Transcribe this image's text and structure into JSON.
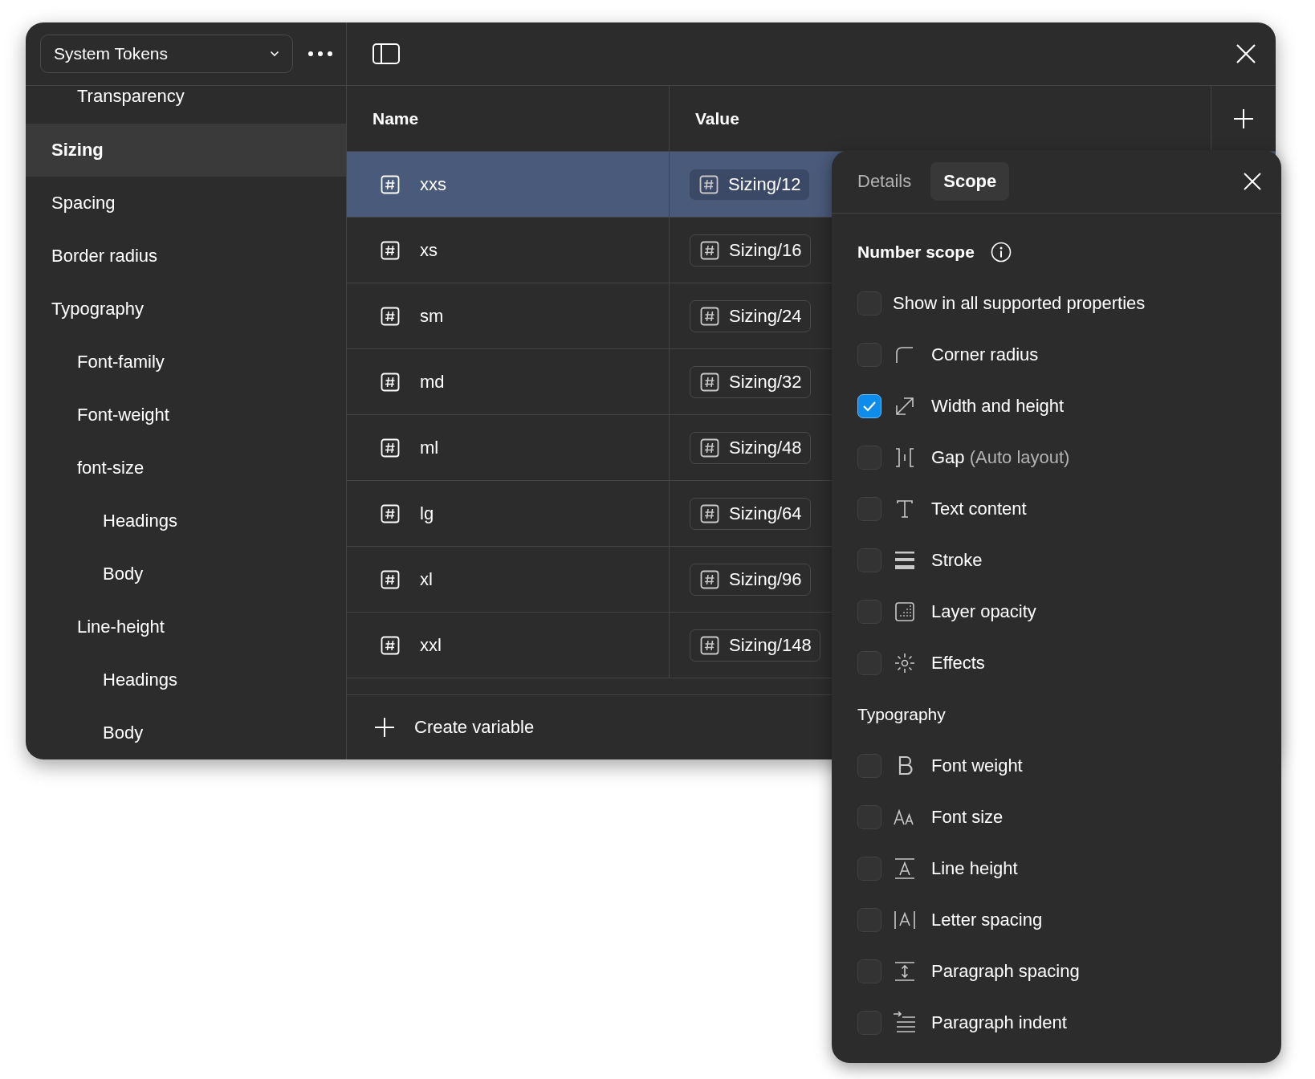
{
  "collection": {
    "name": "System Tokens"
  },
  "sidebar": {
    "items": [
      {
        "children": [
          {
            "label": "Transparency",
            "selected": false
          }
        ]
      },
      {
        "label": "Sizing",
        "selected": true
      },
      {
        "label": "Spacing",
        "selected": false
      },
      {
        "label": "Border radius",
        "selected": false
      },
      {
        "label": "Typography",
        "selected": false,
        "children": [
          {
            "label": "Font-family",
            "selected": false
          },
          {
            "label": "Font-weight",
            "selected": false
          },
          {
            "label": "font-size",
            "selected": false,
            "children": [
              {
                "label": "Headings",
                "selected": false
              },
              {
                "label": "Body",
                "selected": false
              }
            ]
          },
          {
            "label": "Line-height",
            "selected": false,
            "children": [
              {
                "label": "Headings",
                "selected": false
              },
              {
                "label": "Body",
                "selected": false
              }
            ]
          }
        ]
      }
    ]
  },
  "table": {
    "columns": [
      "Name",
      "Value"
    ],
    "rows": [
      {
        "name": "xxs",
        "value": "Sizing/12",
        "selected": true
      },
      {
        "name": "xs",
        "value": "Sizing/16",
        "selected": false
      },
      {
        "name": "sm",
        "value": "Sizing/24",
        "selected": false
      },
      {
        "name": "md",
        "value": "Sizing/32",
        "selected": false
      },
      {
        "name": "ml",
        "value": "Sizing/48",
        "selected": false
      },
      {
        "name": "lg",
        "value": "Sizing/64",
        "selected": false
      },
      {
        "name": "xl",
        "value": "Sizing/96",
        "selected": false
      },
      {
        "name": "xxl",
        "value": "Sizing/148",
        "selected": false
      }
    ],
    "create_label": "Create variable"
  },
  "popover": {
    "tabs": [
      {
        "label": "Details",
        "selected": false
      },
      {
        "label": "Scope",
        "selected": true
      }
    ],
    "sections": [
      {
        "title": "Number scope",
        "info": true,
        "options": [
          {
            "label": "Show in all supported properties",
            "checked": false,
            "kind": "all"
          },
          {
            "label": "Corner radius",
            "checked": false,
            "kind": "corner"
          },
          {
            "label": "Width and height",
            "checked": true,
            "kind": "size"
          },
          {
            "label": "Gap",
            "note": "(Auto layout)",
            "checked": false,
            "kind": "gap"
          },
          {
            "label": "Text content",
            "checked": false,
            "kind": "text"
          },
          {
            "label": "Stroke",
            "checked": false,
            "kind": "stroke"
          },
          {
            "label": "Layer opacity",
            "checked": false,
            "kind": "opacity"
          },
          {
            "label": "Effects",
            "checked": false,
            "kind": "effects"
          }
        ]
      },
      {
        "title": "Typography",
        "info": false,
        "options": [
          {
            "label": "Font weight",
            "checked": false,
            "kind": "weight"
          },
          {
            "label": "Font size",
            "checked": false,
            "kind": "fontsize"
          },
          {
            "label": "Line height",
            "checked": false,
            "kind": "lineheight"
          },
          {
            "label": "Letter spacing",
            "checked": false,
            "kind": "letterspacing"
          },
          {
            "label": "Paragraph spacing",
            "checked": false,
            "kind": "paraspacing"
          },
          {
            "label": "Paragraph indent",
            "checked": false,
            "kind": "indent"
          }
        ]
      }
    ]
  }
}
